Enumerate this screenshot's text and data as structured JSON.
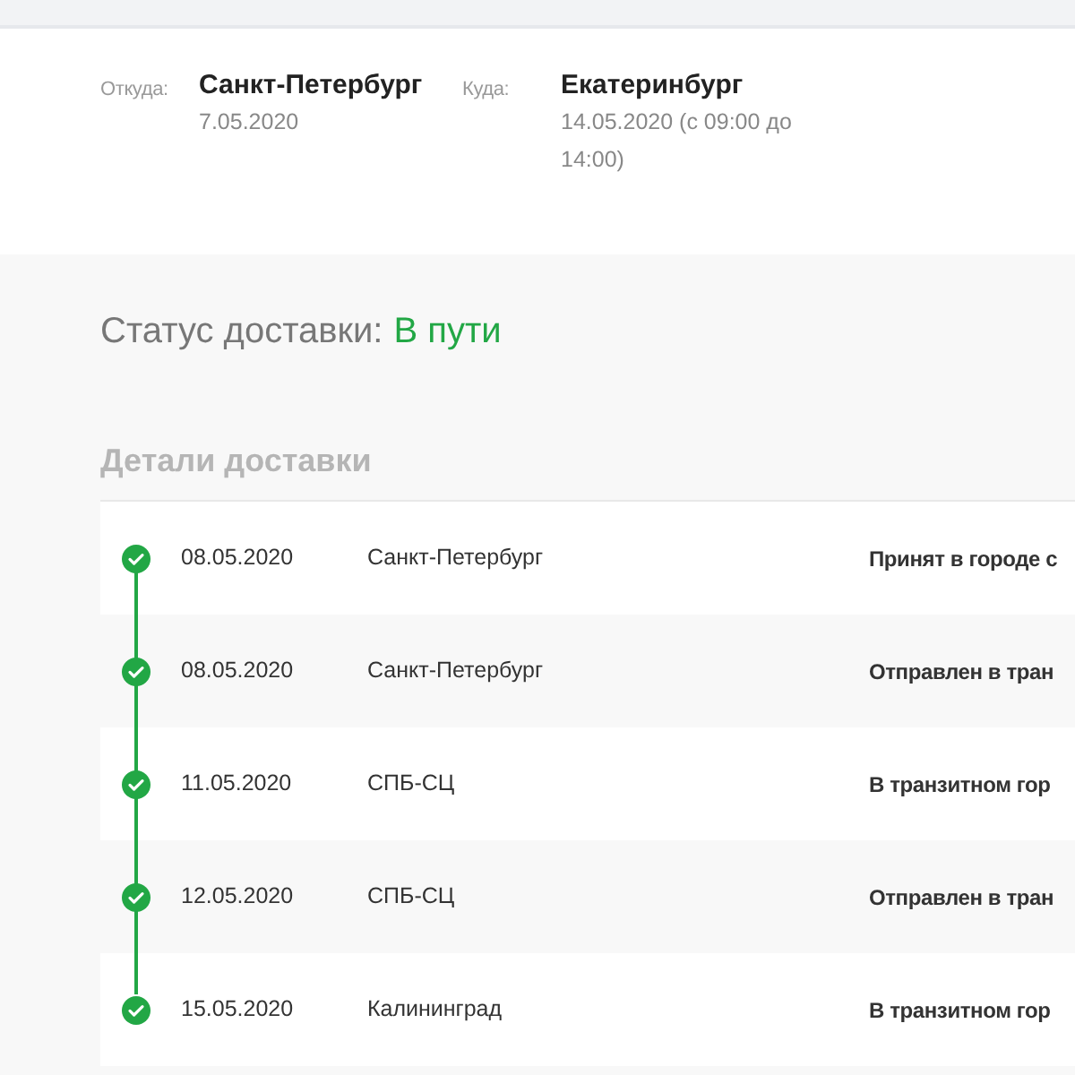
{
  "route": [
    {
      "label": "Откуда:",
      "city": "Санкт-Петербург",
      "date": "7.05.2020"
    },
    {
      "label": "Куда:",
      "city": "Екатеринбург",
      "date": "14.05.2020 (с 09:00 до 14:00)"
    }
  ],
  "status": {
    "label": "Статус доставки:",
    "value": "В пути"
  },
  "details": {
    "title": "Детали доставки",
    "events": [
      {
        "completed": true,
        "date": "08.05.2020",
        "place": "Санкт-Петербург",
        "status": "Принят в городе с"
      },
      {
        "completed": true,
        "date": "08.05.2020",
        "place": "Санкт-Петербург",
        "status": "Отправлен в тран"
      },
      {
        "completed": true,
        "date": "11.05.2020",
        "place": "СПБ-СЦ",
        "status": "В транзитном гор"
      },
      {
        "completed": true,
        "date": "12.05.2020",
        "place": "СПБ-СЦ",
        "status": "Отправлен в тран"
      },
      {
        "completed": true,
        "date": "15.05.2020",
        "place": "Калининград",
        "status": "В транзитном гор"
      }
    ]
  }
}
